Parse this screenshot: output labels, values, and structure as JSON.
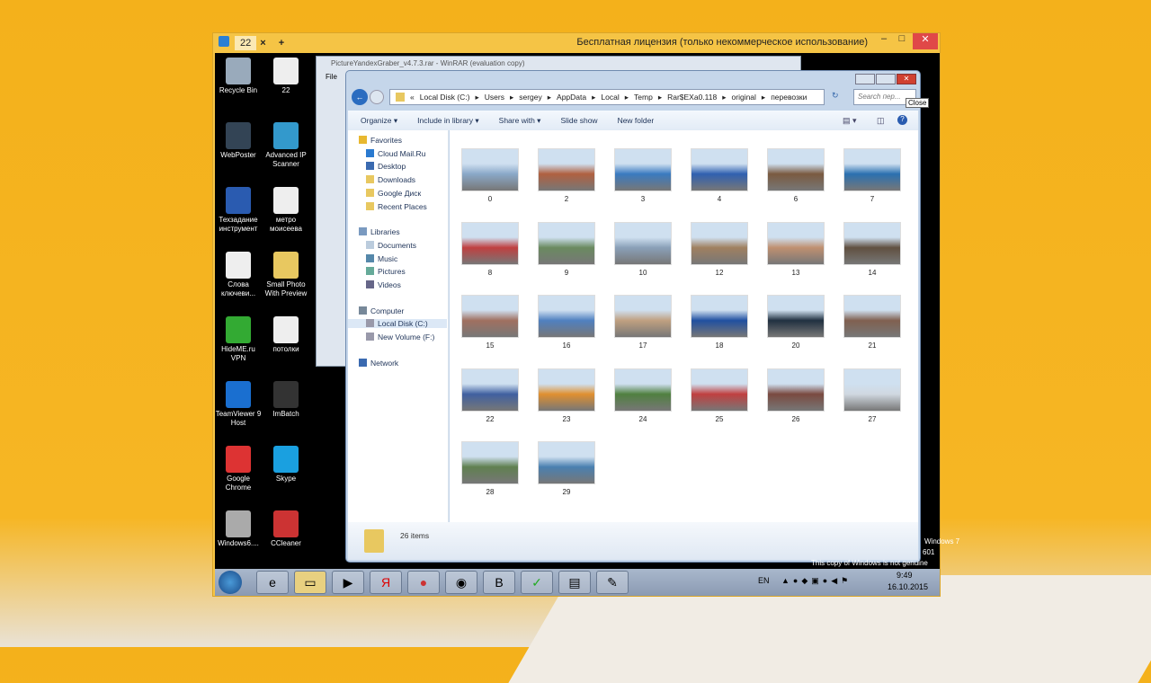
{
  "remote": {
    "tab": "22",
    "title": "Бесплатная лицензия (только некоммерческое использование)"
  },
  "desktop_icons": [
    {
      "label": "Recycle Bin",
      "color": "#9ab"
    },
    {
      "label": "22",
      "color": "#eee"
    },
    {
      "label": "WebPoster",
      "color": "#345"
    },
    {
      "label": "Advanced IP Scanner",
      "color": "#39c"
    },
    {
      "label": "Техзадание инструмент",
      "color": "#2a5bb0"
    },
    {
      "label": "метро моисеева",
      "color": "#eee"
    },
    {
      "label": "Слова ключеви...",
      "color": "#eee"
    },
    {
      "label": "Small Photo With Preview",
      "color": "#e8c860"
    },
    {
      "label": "HideME.ru VPN",
      "color": "#3a3"
    },
    {
      "label": "потолки",
      "color": "#eee"
    },
    {
      "label": "TeamViewer 9 Host",
      "color": "#1a6fd0"
    },
    {
      "label": "ImBatch",
      "color": "#333"
    },
    {
      "label": "Google Chrome",
      "color": "#d33"
    },
    {
      "label": "Skype",
      "color": "#1aa0e0"
    },
    {
      "label": "Windows6....",
      "color": "#aaa"
    },
    {
      "label": "CCleaner",
      "color": "#c33"
    }
  ],
  "winrar": {
    "title": "PictureYandexGraber_v4.7.3.rar - WinRAR (evaluation copy)",
    "menu": "File"
  },
  "explorer": {
    "breadcrumb": [
      "«",
      "Local Disk (C:)",
      "Users",
      "sergey",
      "AppData",
      "Local",
      "Temp",
      "Rar$EXa0.118",
      "original",
      "перевозки"
    ],
    "search_placeholder": "Search пер...",
    "close_tooltip": "Close",
    "toolbar": [
      "Organize ▾",
      "Include in library ▾",
      "Share with ▾",
      "Slide show",
      "New folder"
    ],
    "nav": [
      {
        "label": "Favorites",
        "level": 0,
        "icon": "star"
      },
      {
        "label": "Cloud Mail.Ru",
        "level": 1,
        "icon": "cloud"
      },
      {
        "label": "Desktop",
        "level": 1,
        "icon": "desktop"
      },
      {
        "label": "Downloads",
        "level": 1,
        "icon": "folder"
      },
      {
        "label": "Google Диск",
        "level": 1,
        "icon": "folder"
      },
      {
        "label": "Recent Places",
        "level": 1,
        "icon": "folder"
      },
      {
        "label": "Libraries",
        "level": 0,
        "icon": "library"
      },
      {
        "label": "Documents",
        "level": 1,
        "icon": "doc"
      },
      {
        "label": "Music",
        "level": 1,
        "icon": "music"
      },
      {
        "label": "Pictures",
        "level": 1,
        "icon": "picture"
      },
      {
        "label": "Videos",
        "level": 1,
        "icon": "video"
      },
      {
        "label": "Computer",
        "level": 0,
        "icon": "computer"
      },
      {
        "label": "Local Disk (C:)",
        "level": 1,
        "icon": "drive",
        "selected": true
      },
      {
        "label": "New Volume (F:)",
        "level": 1,
        "icon": "drive"
      },
      {
        "label": "Network",
        "level": 0,
        "icon": "network"
      }
    ],
    "files": [
      {
        "name": "0",
        "color": "#8aa8c8"
      },
      {
        "name": "2",
        "color": "#b06040"
      },
      {
        "name": "3",
        "color": "#3a7ac0"
      },
      {
        "name": "4",
        "color": "#3060b0"
      },
      {
        "name": "6",
        "color": "#7a5a40"
      },
      {
        "name": "7",
        "color": "#2a70b0"
      },
      {
        "name": "8",
        "color": "#c04040"
      },
      {
        "name": "9",
        "color": "#6a8a60"
      },
      {
        "name": "10",
        "color": "#8aa0b8"
      },
      {
        "name": "12",
        "color": "#a08060"
      },
      {
        "name": "13",
        "color": "#c09070"
      },
      {
        "name": "14",
        "color": "#605040"
      },
      {
        "name": "15",
        "color": "#a07060"
      },
      {
        "name": "16",
        "color": "#5080c0"
      },
      {
        "name": "17",
        "color": "#c0a080"
      },
      {
        "name": "18",
        "color": "#2050a0"
      },
      {
        "name": "20",
        "color": "#203040"
      },
      {
        "name": "21",
        "color": "#806050"
      },
      {
        "name": "22",
        "color": "#4060a0"
      },
      {
        "name": "23",
        "color": "#e09030"
      },
      {
        "name": "24",
        "color": "#508040"
      },
      {
        "name": "25",
        "color": "#c04040"
      },
      {
        "name": "26",
        "color": "#7a4a40"
      },
      {
        "name": "27",
        "color": "#d0d8e0"
      },
      {
        "name": "28",
        "color": "#608050"
      },
      {
        "name": "29",
        "color": "#4a80b0"
      }
    ],
    "status": "26 items"
  },
  "watermark": {
    "l1": "Windows 7",
    "l2": "601",
    "l3": "This copy of Windows is not genuine"
  },
  "tray": {
    "lang": "EN",
    "time": "9:49",
    "date": "16.10.2015"
  }
}
